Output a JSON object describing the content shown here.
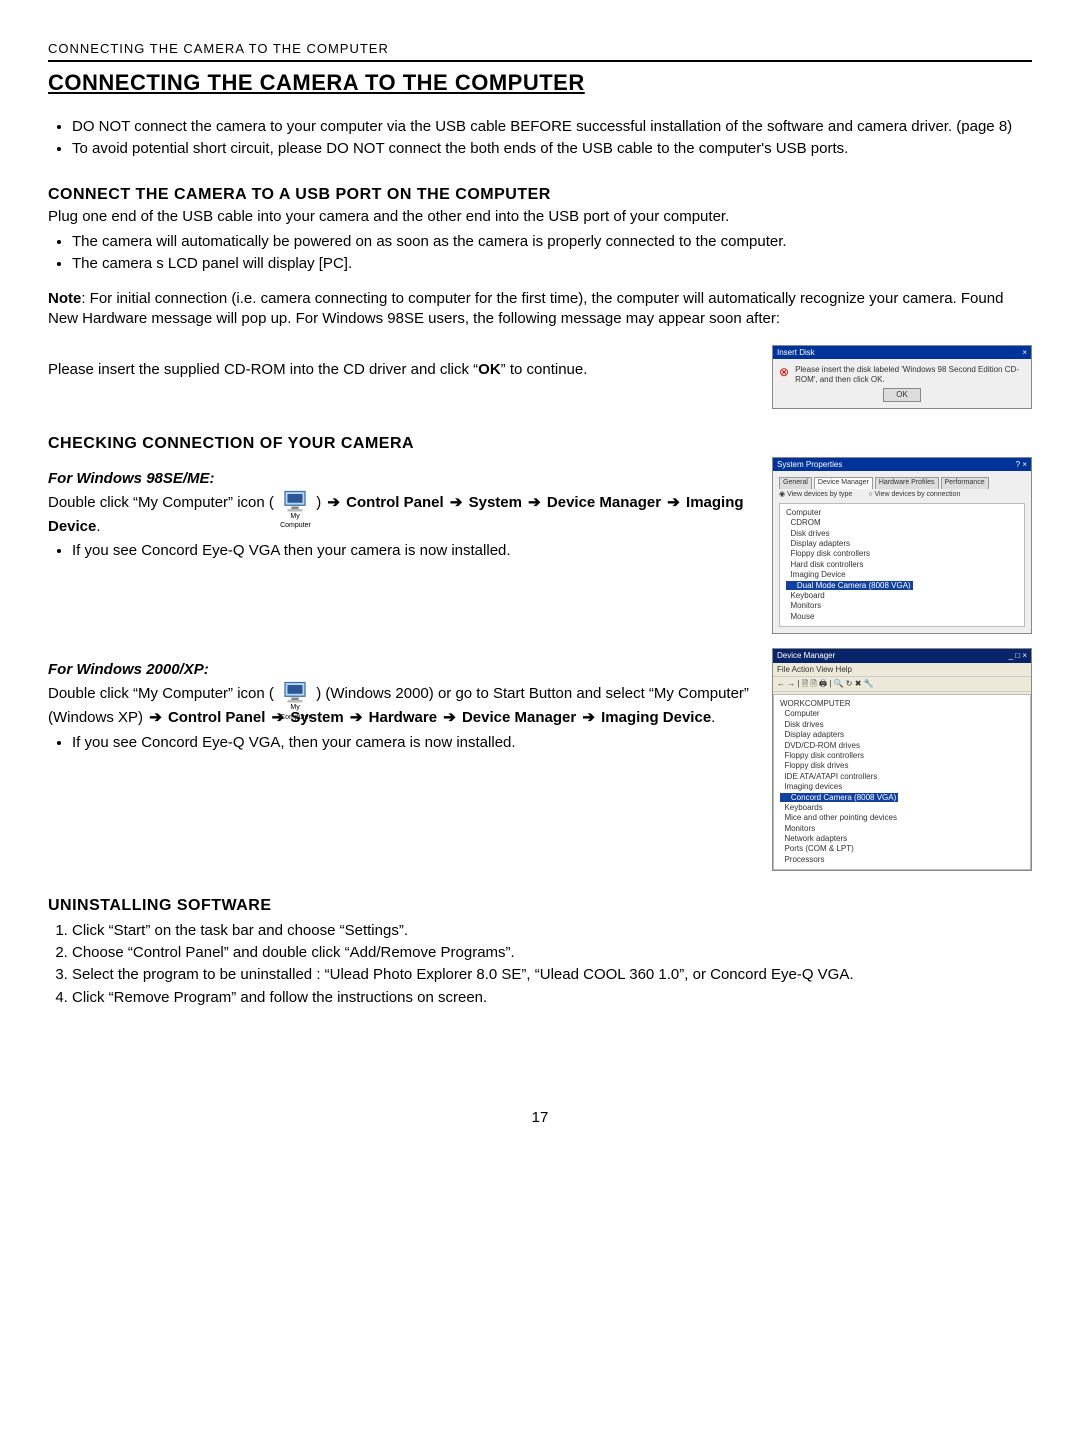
{
  "running_header": "CONNECTING THE CAMERA TO THE COMPUTER",
  "main_title": "CONNECTING THE CAMERA TO THE COMPUTER",
  "intro_bullets": [
    "DO NOT connect the camera to your computer via the USB cable BEFORE successful installation of the software and camera driver. (page 8)",
    "To avoid potential short circuit, please DO NOT connect the both ends of the USB cable to the computer's USB ports."
  ],
  "section_usb": {
    "title": "CONNECT THE CAMERA TO A USB PORT ON THE COMPUTER",
    "lead": "Plug one end of the USB cable into your camera and the other end into the USB port of your computer.",
    "bullets": [
      "The camera will automatically be powered on as soon as the camera is properly connected to the computer.",
      "The camera s LCD panel will display [PC]."
    ],
    "note_prefix": "Note",
    "note_text": ": For initial connection (i.e. camera connecting to computer for the first time), the computer will automatically recognize your camera.  Found New Hardware message will pop up. For Windows 98SE users, the following message may appear soon after:",
    "insert_cd_prefix": "Please insert the supplied CD-ROM into the CD driver and click “",
    "insert_cd_bold": "OK",
    "insert_cd_suffix": "” to continue."
  },
  "insert_disk_dialog": {
    "title": "Insert Disk",
    "body": "Please insert the disk labeled 'Windows 98 Second Edition CD-ROM', and then click OK.",
    "ok": "OK"
  },
  "section_check": {
    "title": "CHECKING CONNECTION OF YOUR CAMERA",
    "win98_head": "For Windows 98SE/ME:",
    "win98_line1_prefix": "Double click “My Computer” icon (  ",
    "win98_line1_suffix": "  ) ",
    "win98_path_cp": "Control Panel",
    "win98_path_sys": "System",
    "win98_path_dm": "Device Manager",
    "win98_path_img": "Imaging Device",
    "win98_bullet": "If you see Concord Eye-Q VGA then your camera is now installed.",
    "winxp_head": "For Windows 2000/XP:",
    "winxp_line1_prefix": "Double click “My Computer” icon (  ",
    "winxp_line1_mid": "  ) (Windows 2000) or go to Start Button and select “My Computer” (Windows XP) ",
    "winxp_path_cp": "Control Panel",
    "winxp_path_sys": "System",
    "winxp_path_hw": "Hardware",
    "winxp_path_dm": "Device Manager",
    "winxp_path_img": "Imaging Device",
    "winxp_bullet": "If you see Concord Eye-Q VGA, then your camera is now installed."
  },
  "sysprops_dialog": {
    "title": "System Properties",
    "tabs": [
      "General",
      "Device Manager",
      "Hardware Profiles",
      "Performance"
    ],
    "radio1": "View devices by type",
    "radio2": "View devices by connection",
    "tree": [
      "Computer",
      "  CDROM",
      "  Disk drives",
      "  Display adapters",
      "  Floppy disk controllers",
      "  Hard disk controllers",
      "  Imaging Device"
    ],
    "tree_hl": "    Dual Mode Camera (8008 VGA)",
    "tree_after": [
      "  Keyboard",
      "  Monitors",
      "  Mouse"
    ]
  },
  "devmgr_dialog": {
    "title": "Device Manager",
    "menu": "File  Action  View  Help",
    "tree": [
      "WORKCOMPUTER",
      "  Computer",
      "  Disk drives",
      "  Display adapters",
      "  DVD/CD-ROM drives",
      "  Floppy disk controllers",
      "  Floppy disk drives",
      "  IDE ATA/ATAPI controllers",
      "  Imaging devices"
    ],
    "tree_hl": "    Concord Camera (8008 VGA)",
    "tree_after": [
      "  Keyboards",
      "  Mice and other pointing devices",
      "  Monitors",
      "  Network adapters",
      "  Ports (COM & LPT)",
      "  Processors"
    ]
  },
  "section_uninstall": {
    "title": "UNINSTALLING SOFTWARE",
    "steps": [
      "Click “Start” on the task bar and choose “Settings”.",
      "Choose “Control Panel” and double click “Add/Remove Programs”.",
      "Select the program to be uninstalled : “Ulead Photo Explorer 8.0 SE”, “Ulead COOL 360 1.0”, or Concord Eye-Q VGA.",
      "Click “Remove Program” and follow the instructions on screen."
    ]
  },
  "mycomputer_label": "My Computer",
  "page_number": "17"
}
